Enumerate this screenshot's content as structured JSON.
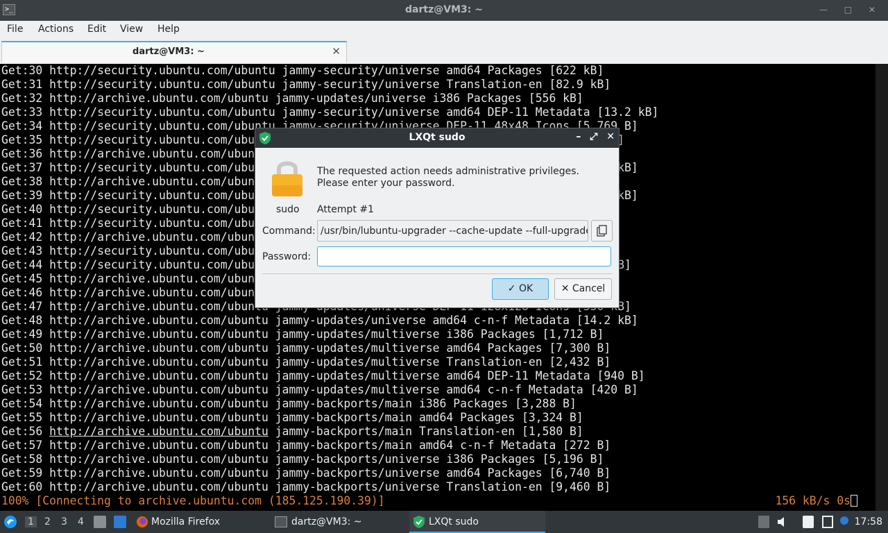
{
  "window": {
    "title": "dartz@VM3: ~",
    "term_icon": ">_",
    "controls": "— □ ✕"
  },
  "menu": [
    "File",
    "Actions",
    "Edit",
    "View",
    "Help"
  ],
  "tab": {
    "label": "dartz@VM3: ~",
    "close": "✕"
  },
  "terminal": {
    "lines": [
      "Get:30 http://security.ubuntu.com/ubuntu jammy-security/universe amd64 Packages [622 kB]",
      "Get:31 http://security.ubuntu.com/ubuntu jammy-security/universe Translation-en [82.9 kB]",
      "Get:32 http://archive.ubuntu.com/ubuntu jammy-updates/universe i386 Packages [556 kB]",
      "Get:33 http://security.ubuntu.com/ubuntu jammy-security/universe amd64 DEP-11 Metadata [13.2 kB]",
      "Get:34 http://security.ubuntu.com/ubuntu jammy-security/universe DEP-11 48x48 Icons [5,769 B]",
      "Get:35 http://security.ubuntu.com/ubu                                                   kB]",
      "Get:36 http://archive.ubuntu.com/ubun",
      "Get:37 http://security.ubuntu.com/ubu                                                  .2 kB]",
      "Get:38 http://archive.ubuntu.com/ubun",
      "Get:39 http://security.ubuntu.com/ubu                                                  .0 kB]",
      "Get:40 http://security.ubuntu.com/ubu                                                  ]",
      "Get:41 http://security.ubuntu.com/ubu                                                 ]",
      "Get:42 http://archive.ubuntu.com/ubun                                                  kB]",
      "Get:43 http://security.ubuntu.com/ubu",
      "Get:44 http://security.ubuntu.com/ubu                                                 228 B]",
      "Get:45 http://archive.ubuntu.com/ubun                                                  ]",
      "Get:46 http://archive.ubuntu.com/ubun                                                  ]",
      "Get:47 http://archive.ubuntu.com/ubuntu jammy-updates/universe DEP-11 128x128 Icons [330 kB]",
      "Get:48 http://archive.ubuntu.com/ubuntu jammy-updates/universe amd64 c-n-f Metadata [14.2 kB]",
      "Get:49 http://archive.ubuntu.com/ubuntu jammy-updates/multiverse i386 Packages [1,712 B]",
      "Get:50 http://archive.ubuntu.com/ubuntu jammy-updates/multiverse amd64 Packages [7,300 B]",
      "Get:51 http://archive.ubuntu.com/ubuntu jammy-updates/multiverse Translation-en [2,432 B]",
      "Get:52 http://archive.ubuntu.com/ubuntu jammy-updates/multiverse amd64 DEP-11 Metadata [940 B]",
      "Get:53 http://archive.ubuntu.com/ubuntu jammy-updates/multiverse amd64 c-n-f Metadata [420 B]",
      "Get:54 http://archive.ubuntu.com/ubuntu jammy-backports/main i386 Packages [3,288 B]",
      "Get:55 http://archive.ubuntu.com/ubuntu jammy-backports/main amd64 Packages [3,324 B]",
      "Get:56 ",
      "Get:57 http://archive.ubuntu.com/ubuntu jammy-backports/main amd64 c-n-f Metadata [272 B]",
      "Get:58 http://archive.ubuntu.com/ubuntu jammy-backports/universe i386 Packages [5,196 B]",
      "Get:59 http://archive.ubuntu.com/ubuntu jammy-backports/universe amd64 Packages [6,740 B]",
      "Get:60 http://archive.ubuntu.com/ubuntu jammy-backports/universe Translation-en [9,460 B]"
    ],
    "line56_link": "http://archive.ubuntu.com/ubuntu",
    "line56_rest": " jammy-backports/main Translation-en [1,580 B]",
    "status_left": "100% [Connecting to archive.ubuntu.com (185.125.190.39)]",
    "status_right": "156 kB/s 0s"
  },
  "dialog": {
    "title": "LXQt sudo",
    "controls": [
      "–",
      "⤢",
      "✕"
    ],
    "message_line1": "The requested action needs administrative privileges.",
    "message_line2": "Please enter your password.",
    "icon_label": "sudo",
    "attempt": "Attempt #1",
    "command_label": "Command:",
    "command_value": "/usr/bin/lubuntu-upgrader --cache-update --full-upgrade",
    "password_label": "Password:",
    "password_value": "",
    "ok_label": "OK",
    "cancel_label": "Cancel",
    "ok_icon": "✓",
    "cancel_icon": "✕"
  },
  "taskbar": {
    "workspaces": [
      "1",
      "2",
      "3",
      "4"
    ],
    "tasks": [
      {
        "label": "Mozilla Firefox"
      },
      {
        "label": "dartz@VM3: ~"
      },
      {
        "label": "LXQt sudo"
      }
    ],
    "clock": "17:58"
  },
  "colors": {
    "accent": "#3daee9",
    "terminal_bg": "#000000",
    "terminal_fg": "#e5e5e5",
    "status_fg": "#d9803c",
    "panel_bg": "#31363b"
  }
}
